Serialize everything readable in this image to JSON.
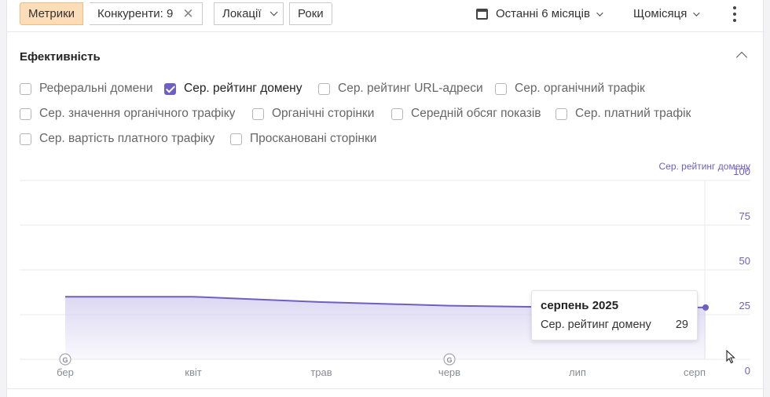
{
  "toolbar": {
    "metrics_label": "Метрики",
    "competitors_label": "Конкуренти: 9",
    "locations_label": "Локації",
    "years_label": "Роки",
    "period_label": "Останні 6 місяців",
    "interval_label": "Щомісяця"
  },
  "section": {
    "title": "Ефективність"
  },
  "metrics": [
    {
      "label": "Реферальні домени",
      "checked": false
    },
    {
      "label": "Сер. рейтинг домену",
      "checked": true
    },
    {
      "label": "Сер. рейтинг URL-адреси",
      "checked": false
    },
    {
      "label": "Сер. органічний трафік",
      "checked": false
    },
    {
      "label": "Сер. значення органічного трафіку",
      "checked": false
    },
    {
      "label": "Органічні сторінки",
      "checked": false
    },
    {
      "label": "Середній обсяг показів",
      "checked": false
    },
    {
      "label": "Сер. платний трафік",
      "checked": false
    },
    {
      "label": "Сер. вартість платного трафіку",
      "checked": false
    },
    {
      "label": "Проскановані сторінки",
      "checked": false
    }
  ],
  "chart_data": {
    "type": "area",
    "categories": [
      "бер",
      "квіт",
      "трав",
      "черв",
      "лип",
      "серп"
    ],
    "series": [
      {
        "name": "Сер. рейтинг домену",
        "values": [
          35,
          35,
          32,
          30,
          29,
          29
        ]
      }
    ],
    "ylabel": "Сер. рейтинг домену",
    "yticks": [
      "0",
      "25",
      "50",
      "75",
      "100"
    ],
    "ylim": [
      0,
      100
    ],
    "y_axis_position": "right",
    "annotation_markers": [
      "G",
      "G"
    ],
    "colors": {
      "line": "#6e5fc2",
      "fill": "#d9d4f1"
    }
  },
  "tooltip": {
    "title": "серпень 2025",
    "metric": "Сер. рейтинг домену",
    "value": "29"
  }
}
